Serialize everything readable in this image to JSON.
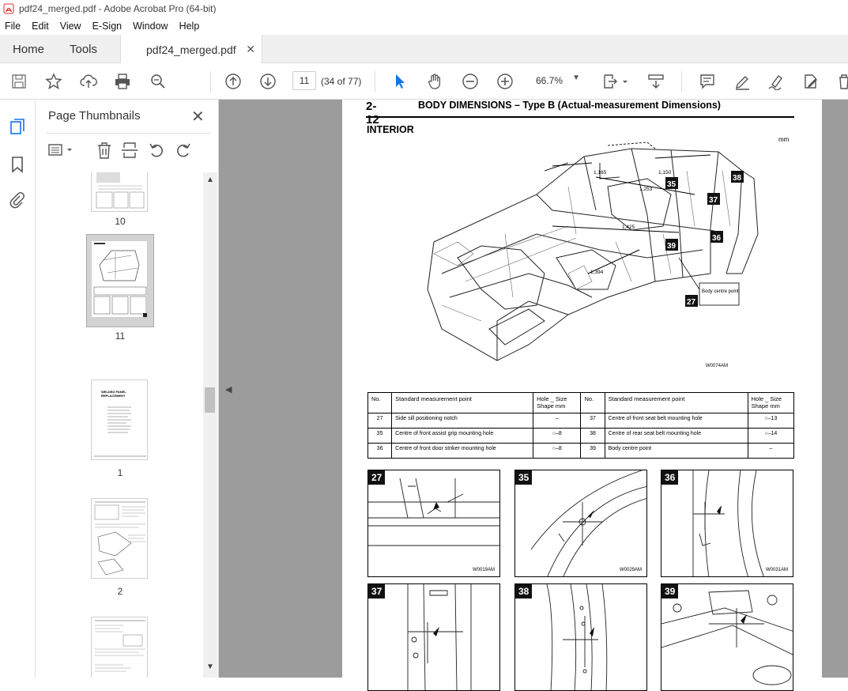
{
  "window": {
    "title": "pdf24_merged.pdf - Adobe Acrobat Pro (64-bit)"
  },
  "menu": [
    "File",
    "Edit",
    "View",
    "E-Sign",
    "Window",
    "Help"
  ],
  "tabs": {
    "home": "Home",
    "tools": "Tools",
    "document": "pdf24_merged.pdf"
  },
  "toolbar": {
    "page_number": "11",
    "page_count": "(34 of 77)",
    "zoom": "66.7%"
  },
  "panel": {
    "title": "Page Thumbnails",
    "thumbnails": [
      {
        "label": "10"
      },
      {
        "label": "11"
      },
      {
        "label": "1",
        "heading": "WELDED PANEL REPLACEMENT"
      },
      {
        "label": "2"
      },
      {
        "label": ""
      }
    ]
  },
  "pdf": {
    "page_number": "2-12",
    "title": "BODY DIMENSIONS – Type B (Actual-measurement Dimensions)",
    "section": "INTERIOR",
    "unit": "mm",
    "figure_code": "W0074AM",
    "dimensions": [
      "1,165",
      "1,150",
      "1,253",
      "1,425",
      "1,394"
    ],
    "callouts": [
      "38",
      "35",
      "37",
      "36",
      "39",
      "27"
    ],
    "callout_note": "Body centre point",
    "table": {
      "headers": [
        "No.",
        "Standard measurement point",
        "Hole _ Size",
        "Shape mm",
        "No.",
        "Standard measurement point",
        "Hole _ Size",
        "Shape mm"
      ],
      "rows": [
        [
          "27",
          "Side sill positioning notch",
          "–",
          "37",
          "Centre of front seat belt mounting hole",
          "○–13"
        ],
        [
          "35",
          "Centre of front assist grip mounting hole",
          "○–8",
          "38",
          "Centre of rear seat belt mounting hole",
          "○–14"
        ],
        [
          "36",
          "Centre of front door striker mounting hole",
          "○–8",
          "39",
          "Body centre point",
          "–"
        ]
      ]
    },
    "details": [
      {
        "label": "27",
        "code": "W0019AM"
      },
      {
        "label": "35",
        "code": "W0029AM"
      },
      {
        "label": "36",
        "code": "W0031AM"
      },
      {
        "label": "37",
        "code": ""
      },
      {
        "label": "38",
        "code": ""
      },
      {
        "label": "39",
        "code": ""
      }
    ]
  }
}
